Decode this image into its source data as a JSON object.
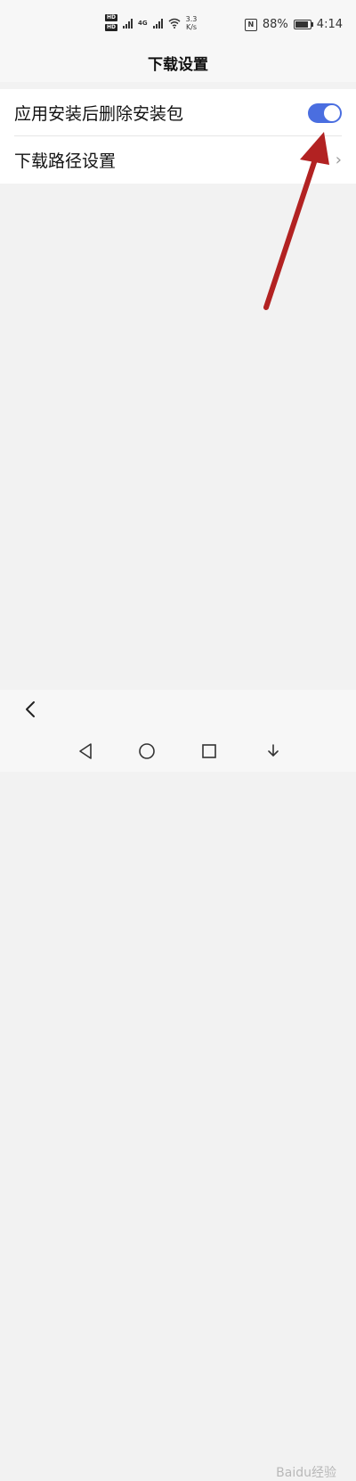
{
  "status_bar": {
    "hd1": "HD",
    "hd2": "HD",
    "network": "4G",
    "speed_value": "3.3",
    "speed_unit": "K/s",
    "nfc_label": "N",
    "battery_percent": "88%",
    "battery_level": 0.88,
    "time": "4:14"
  },
  "header": {
    "title": "下载设置"
  },
  "settings": [
    {
      "label": "应用安装后删除安装包",
      "control": "toggle",
      "toggle_on": true
    },
    {
      "label": "下载路径设置",
      "control": "chevron",
      "chevron_glyph": "›"
    }
  ],
  "nav": {
    "icons": [
      "back-triangle-icon",
      "home-circle-icon",
      "recent-square-icon",
      "download-icon"
    ]
  },
  "watermark": "Baidu经验",
  "colors": {
    "accent": "#4a6ee0",
    "annotation_arrow": "#b22222"
  }
}
